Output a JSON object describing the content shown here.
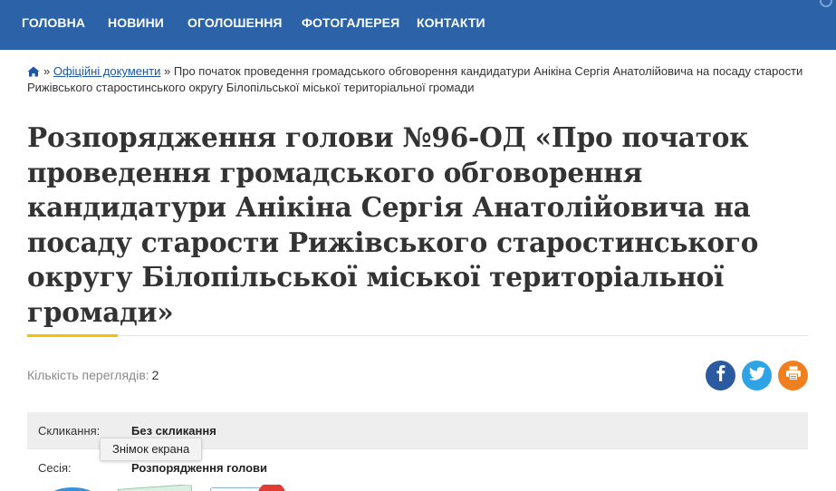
{
  "nav": {
    "items": [
      {
        "label": "ГОЛОВНА"
      },
      {
        "label": "НОВИНИ"
      },
      {
        "label": "ОГОЛОШЕННЯ"
      },
      {
        "label": "ФОТОГАЛЕРЕЯ"
      },
      {
        "label": "КОНТАКТИ"
      }
    ]
  },
  "breadcrumb": {
    "home_icon": "home-icon",
    "separator": "»",
    "link_label": "Офіційні документи",
    "current": "Про початок проведення громадського обговорення кандидатури Анікіна Сергія Анатолійовича на посаду старости Рижівського старостинського округу Білопільської міської територіальної громади"
  },
  "page": {
    "title": "Розпорядження голови №96-ОД «Про початок проведення громадського обговорення кандидатури Анікіна Сергія Анатолійовича на посаду старости Рижівського старостинського округу Білопільської міської територіальної громади»",
    "views_label": "Кількість переглядів:",
    "views_count": "2"
  },
  "share": {
    "facebook_icon": "facebook-icon",
    "twitter_icon": "twitter-icon",
    "print_icon": "print-icon",
    "colors": {
      "facebook": "#2b5aa0",
      "twitter": "#2ea3e6",
      "print": "#f07f1f"
    }
  },
  "info": {
    "rows": [
      {
        "label": "Скликання:",
        "value": "Без скликання"
      },
      {
        "label": "Сесія:",
        "value": "Розпорядження голови"
      }
    ]
  },
  "tooltip": {
    "text": "Знімок екрана"
  },
  "theme": {
    "nav_bg": "#2c62a8",
    "accent": "#f2c200",
    "link": "#1e56a0"
  }
}
